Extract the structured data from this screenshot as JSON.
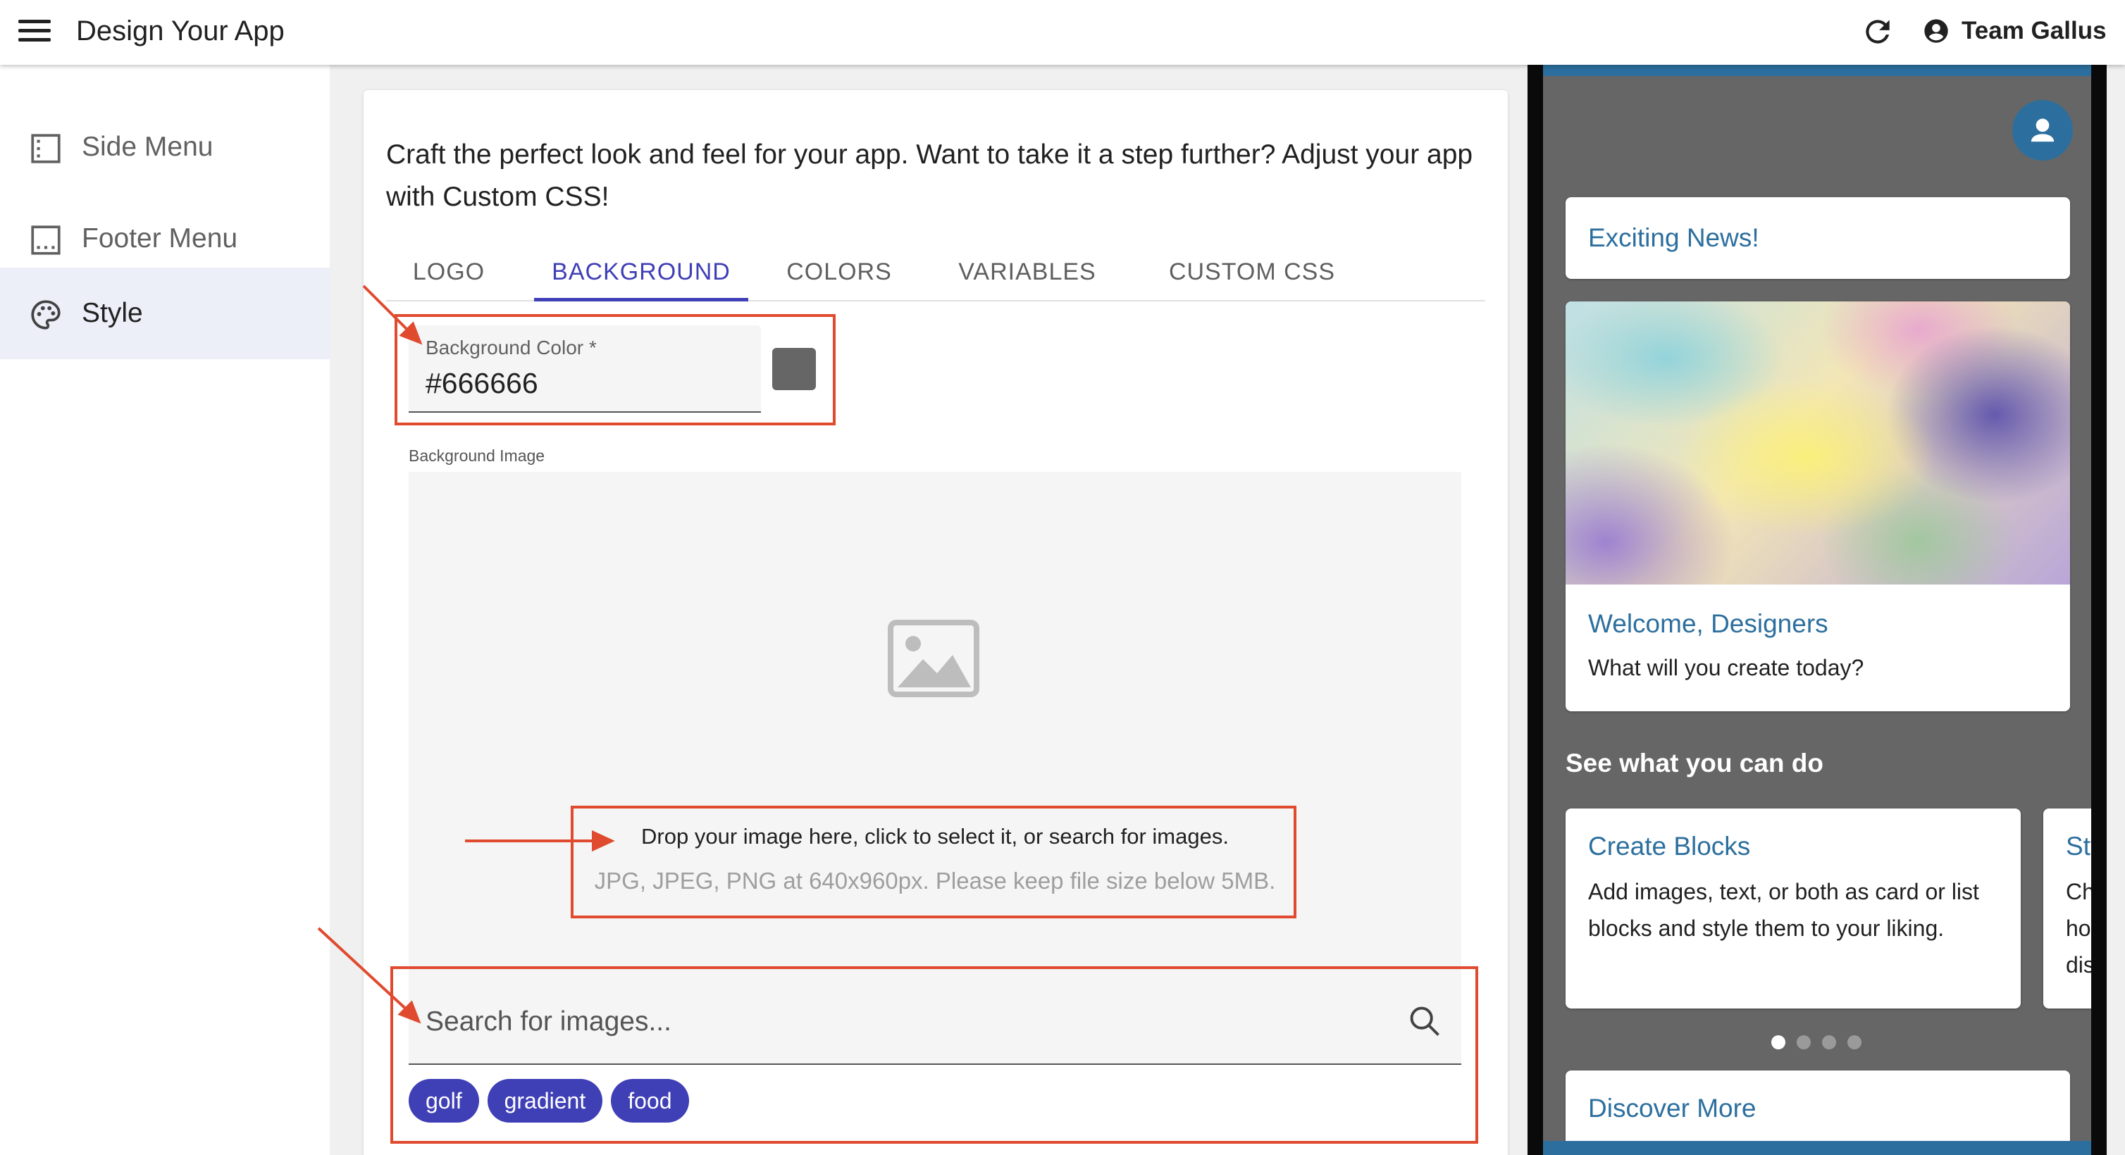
{
  "topbar": {
    "title": "Design Your App",
    "user_name": "Team Gallus",
    "icons": [
      "hamburger-menu-icon",
      "refresh-icon",
      "account-circle-icon"
    ]
  },
  "sidebar": {
    "items": [
      {
        "label": "Side Menu",
        "icon": "side-menu-icon",
        "active": false
      },
      {
        "label": "Footer Menu",
        "icon": "footer-menu-icon",
        "active": false
      },
      {
        "label": "Style",
        "icon": "palette-icon",
        "active": true
      }
    ]
  },
  "main": {
    "intro": "Craft the perfect look and feel for your app. Want to take it a step further? Adjust your app with Custom CSS!",
    "tabs": [
      {
        "label": "LOGO",
        "active": false
      },
      {
        "label": "BACKGROUND",
        "active": true
      },
      {
        "label": "COLORS",
        "active": false
      },
      {
        "label": "VARIABLES",
        "active": false
      },
      {
        "label": "CUSTOM CSS",
        "active": false
      }
    ],
    "background_color": {
      "label": "Background Color *",
      "value": "#666666",
      "swatch_color": "#666666"
    },
    "background_image": {
      "label": "Background Image",
      "placeholder_icon": "image-placeholder-icon",
      "drop_text": "Drop your image here, click to select it, or search for images.",
      "drop_hint": "JPG, JPEG, PNG at 640x960px. Please keep file size below 5MB."
    },
    "image_search": {
      "placeholder": "Search for images...",
      "icon": "search-icon",
      "chips": [
        "golf",
        "gradient",
        "food"
      ]
    }
  },
  "preview": {
    "exciting_news": "Exciting News!",
    "welcome_title": "Welcome, Designers",
    "welcome_body": "What will you create today?",
    "section_heading": "See what you can do",
    "carousel": [
      {
        "title": "Create Blocks",
        "body": "Add images, text, or both as card or list blocks and style them to your liking."
      },
      {
        "title": "Sty",
        "body_lines": [
          "Ch",
          "ho",
          "dis"
        ]
      }
    ],
    "carousel_dots": 4,
    "carousel_active_dot": 1,
    "discover_more": "Discover More"
  },
  "colors": {
    "accent": "#3f3fb6",
    "preview_blue": "#2c6f9e",
    "annotation_red": "#e04b2f",
    "preview_background": "#666666"
  }
}
